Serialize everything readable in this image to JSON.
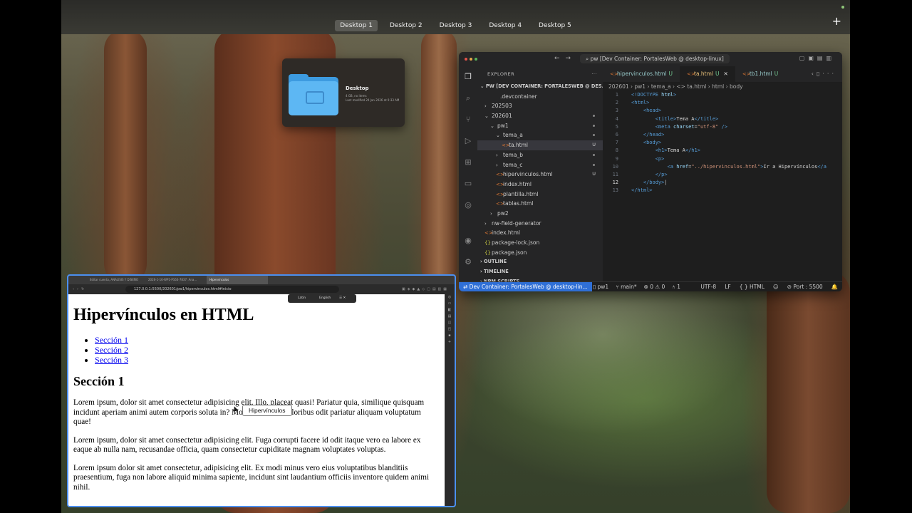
{
  "desktops": {
    "tabs": [
      "Desktop 1",
      "Desktop 2",
      "Desktop 3",
      "Desktop 4",
      "Desktop 5"
    ],
    "active": "Desktop 1",
    "add_label": "+"
  },
  "finder": {
    "name": "Desktop",
    "sub1": "4 GB, no items",
    "sub2": "Last modified 24 Jan 2026 at 9:33 AM"
  },
  "vscode": {
    "command_center": "pw [Dev Container: PortalesWeb @ desktop-linux]",
    "explorer_label": "EXPLORER",
    "explorer_more": "···",
    "workspace": "PW [DEV CONTAINER: PORTALESWEB @ DES...",
    "tree": [
      {
        "label": ".devcontainer",
        "indent": 22,
        "prefix": ""
      },
      {
        "label": "202503",
        "indent": 10,
        "prefix": "›"
      },
      {
        "label": "202601",
        "indent": 10,
        "prefix": "⌄",
        "dot": true
      },
      {
        "label": "pw1",
        "indent": 18,
        "prefix": "⌄",
        "dot": true
      },
      {
        "label": "tema_a",
        "indent": 26,
        "prefix": "⌄",
        "dot": true
      },
      {
        "label": "ta.html",
        "indent": 34,
        "prefix": "<>",
        "badge": "U",
        "selected": true
      },
      {
        "label": "tema_b",
        "indent": 26,
        "prefix": "›",
        "dot": true
      },
      {
        "label": "tema_c",
        "indent": 26,
        "prefix": "›",
        "dot": true
      },
      {
        "label": "hipervinculos.html",
        "indent": 26,
        "prefix": "<>",
        "badge": "U"
      },
      {
        "label": "index.html",
        "indent": 26,
        "prefix": "<>"
      },
      {
        "label": "plantilla.html",
        "indent": 26,
        "prefix": "<>"
      },
      {
        "label": "tablas.html",
        "indent": 26,
        "prefix": "<>"
      },
      {
        "label": "pw2",
        "indent": 18,
        "prefix": "›"
      },
      {
        "label": "nw-field-generator",
        "indent": 10,
        "prefix": "›"
      },
      {
        "label": "index.html",
        "indent": 10,
        "prefix": "<>"
      },
      {
        "label": "package-lock.json",
        "indent": 10,
        "prefix": "{}"
      },
      {
        "label": "package.json",
        "indent": 10,
        "prefix": "{}"
      }
    ],
    "sections": [
      "OUTLINE",
      "TIMELINE",
      "NPM SCRIPTS"
    ],
    "tabs": [
      {
        "label": "hipervinculos.html",
        "badge": "U"
      },
      {
        "label": "ta.html",
        "badge": "U",
        "active": true
      },
      {
        "label": "tb1.html",
        "badge": "U"
      }
    ],
    "breadcrumbs": "202601 › pw1 › tema_a › <> ta.html › html › body",
    "status": {
      "remote": "Dev Container: PortalesWeb @ desktop-lin...",
      "project": "pw1",
      "branch": "main*",
      "errors": "⊗ 0 ⚠ 0",
      "ports": "1",
      "encoding": "UTF-8",
      "eol": "LF",
      "language": "{ } HTML",
      "live_server": "Port : 5500"
    },
    "cursor_line": 12
  },
  "browser": {
    "tabs": [
      "Editar cuenta, ANALISIS Y DISEÑO",
      "2026-1-16-WP1-P163-7837: Ana...",
      "Hipervínculos"
    ],
    "url": "127.0.0.1:5500/202601/pw1/hipervinculos.html#inicio",
    "popup": {
      "left": "Latin",
      "right": "English"
    },
    "page": {
      "h1": "Hipervínculos en HTML",
      "links": [
        "Sección 1",
        "Sección 2",
        "Sección 3"
      ],
      "h2": "Sección 1",
      "paragraphs": [
        "Lorem ipsum, dolor sit amet consectetur adipisicing elit. Illo, placeat quasi! Pariatur quia, similique quisquam incidunt aperiam animi autem corporis soluta in? Mollitia, dolore doloribus odit pariatur aliquam voluptatum quae!",
        "Lorem ipsum, dolor sit amet consectetur adipisicing elit. Fuga corrupti facere id odit itaque vero ea labore ex eaque ab nulla nam, recusandae officia, quam consectetur cupiditate magnam voluptates voluptas.",
        "Lorem ipsum dolor sit amet consectetur, adipisicing elit. Ex modi minus vero eius voluptatibus blanditiis praesentium, fuga non labore aliquid minima sapiente, incidunt sint laudantium officiis inventore quidem animi nihil."
      ]
    },
    "tooltip": "Hipervínculos"
  }
}
